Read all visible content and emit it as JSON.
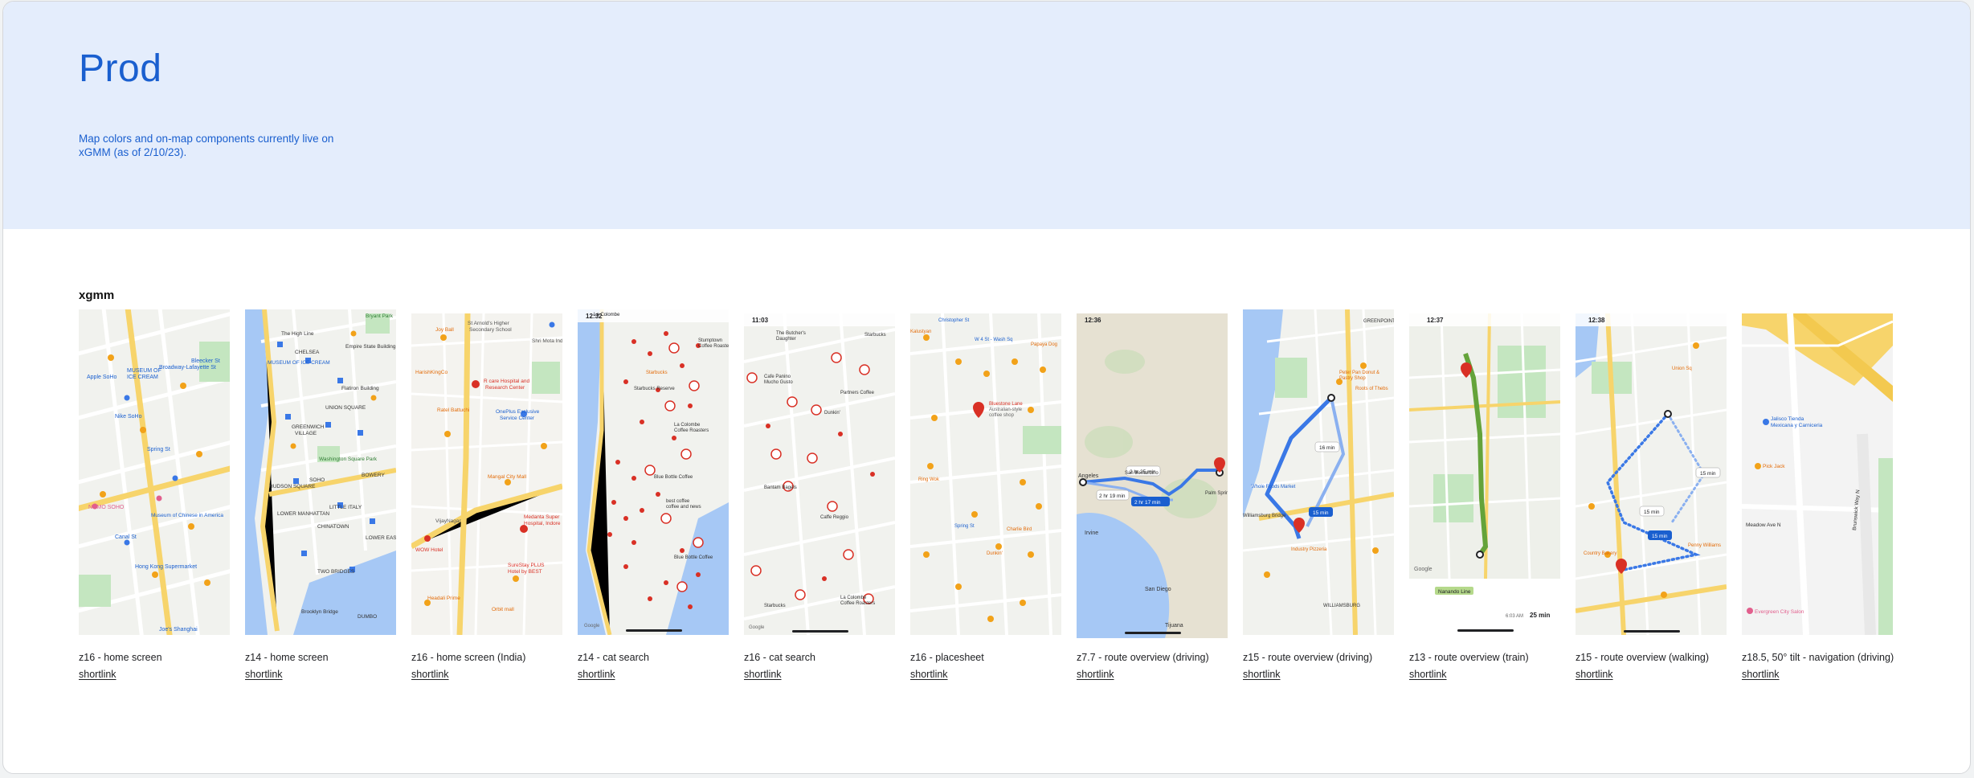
{
  "header": {
    "title": "Prod",
    "description": "Map colors and on-map components currently live on xGMM (as of 2/10/23)."
  },
  "section": {
    "label": "xgmm"
  },
  "cards": [
    {
      "caption": "z16 - home screen",
      "link": "shortlink",
      "kind": "city"
    },
    {
      "caption": "z14 - home screen",
      "link": "shortlink",
      "kind": "city-wide"
    },
    {
      "caption": "z16 - home screen (India)",
      "link": "shortlink",
      "kind": "india"
    },
    {
      "caption": "z14 - cat search",
      "link": "shortlink",
      "kind": "cat-search"
    },
    {
      "caption": "z16 - cat search",
      "link": "shortlink",
      "kind": "cat-search-16"
    },
    {
      "caption": "z16 - placesheet",
      "link": "shortlink",
      "kind": "placesheet"
    },
    {
      "caption": "z7.7 - route overview (driving)",
      "link": "shortlink",
      "kind": "route-regional"
    },
    {
      "caption": "z15 - route overview (driving)",
      "link": "shortlink",
      "kind": "route-driving"
    },
    {
      "caption": "z13 - route overview (train)",
      "link": "shortlink",
      "kind": "route-train"
    },
    {
      "caption": "z15 - route overview (walking)",
      "link": "shortlink",
      "kind": "route-walking"
    },
    {
      "caption": "z18.5, 50° tilt - navigation (driving)",
      "link": "shortlink",
      "kind": "navigation"
    }
  ],
  "map_labels": {
    "card1": [
      "MUSEUM OF ICE CREAM",
      "Bleecker St",
      "Apple SoHo",
      "Broadway-Lafayette St",
      "Nike SoHo",
      "Spring St",
      "NOMO SOHO",
      "Museum of Chinese in America",
      "Canal St",
      "Hong Kong Supermarket",
      "Joe's Shanghai"
    ],
    "card2": [
      "The High Line",
      "Bryant Park",
      "CHELSEA",
      "Empire State Building",
      "MUSEUM OF ICE CREAM",
      "Flatiron Building",
      "UNION SQUARE",
      "GREENWICH VILLAGE",
      "Washington Square Park",
      "HUDSON SQUARE",
      "SOHO",
      "BOWERY",
      "LOWER MANHATTAN",
      "LITTLE ITALY",
      "CHINATOWN",
      "LOWER EAST SIDE",
      "TWO BRIDGES",
      "Brooklyn Bridge",
      "DUMBO"
    ],
    "card3": [
      "Joy Ball",
      "St Arnold's Higher Secondary School",
      "Shri Mota Ind",
      "HarishKingCo",
      "R care Hospital and Research Center",
      "Ratel Battuchi",
      "OnePlus Exclusive Service Center",
      "Mangal City Mall",
      "VijayNagar",
      "Medanta Super Hospital, Indore",
      "WOW Hotel",
      "SureStay PLUS Hotel by BEST",
      "Headali Prime",
      "Orbit mall"
    ],
    "card4": [
      "La Colombe",
      "12:32",
      "Stumptown Coffee Roasters",
      "Starbucks",
      "Blue Bottle Coffee",
      "La Colombe Coffee Roasters",
      "Blue Bottle Coffee",
      "best coffee coffee and news",
      "Starbucks Reserve",
      "Google"
    ],
    "card5": [
      "11:03",
      "The Butcher's Daughter",
      "Starbucks",
      "Cafe Panino Mucho Gusto",
      "Partners Coffee",
      "Dunkin'",
      "Bantam Bagels",
      "Caffe Reggio",
      "La Colombe Coffee Roasters",
      "Starbucks",
      "Google"
    ],
    "card6": [
      "Christopher St",
      "Kalustyan",
      "W 4 St - Wash Sq",
      "Papaya Dog",
      "Bluestone Lane",
      "Australian-style coffee shop",
      "Ring Wok",
      "Spring St",
      "Charlie Bird",
      "Dunkin'"
    ],
    "card7": [
      "12:36",
      "Angeles",
      "San Bernardino",
      "2 hr 25 min",
      "2 hr 19 min",
      "2 hr 17 min",
      "Irvine",
      "San Diego",
      "Tijuana",
      "Palm Springs"
    ],
    "card8": [
      "GREENPOINT",
      "Peter Pan Donut & Pastry Shop",
      "Roots of Thebs",
      "16 min",
      "15 min",
      "Whole Foods Market",
      "Williamsburg Bridge",
      "Industry Pizzeria",
      "WILLIAMSBURG"
    ],
    "card9": [
      "12:37",
      "Nanando Line",
      "Google",
      "6:03 AM",
      "25 min"
    ],
    "card10": [
      "12:38",
      "Union Sq",
      "15 min",
      "15 min",
      "15 min",
      "Penny Williams",
      "Country Bakery"
    ],
    "card11": [
      "Jalisco Tienda Mexicana y Carniceria",
      "Meadow Ave N",
      "Evergreen City Salon",
      "Brunswick Way N"
    ]
  },
  "colors": {
    "banner_bg": "#e4edfc",
    "title": "#1a5fcf",
    "route_blue": "#3a78e6",
    "transit_green": "#64a33a",
    "pin_red": "#d93025",
    "pin_orange": "#f2a219",
    "water": "#a6c8f5",
    "park": "#c4e6c0",
    "road_yellow": "#f7d46b",
    "land": "#f1f2ee"
  }
}
